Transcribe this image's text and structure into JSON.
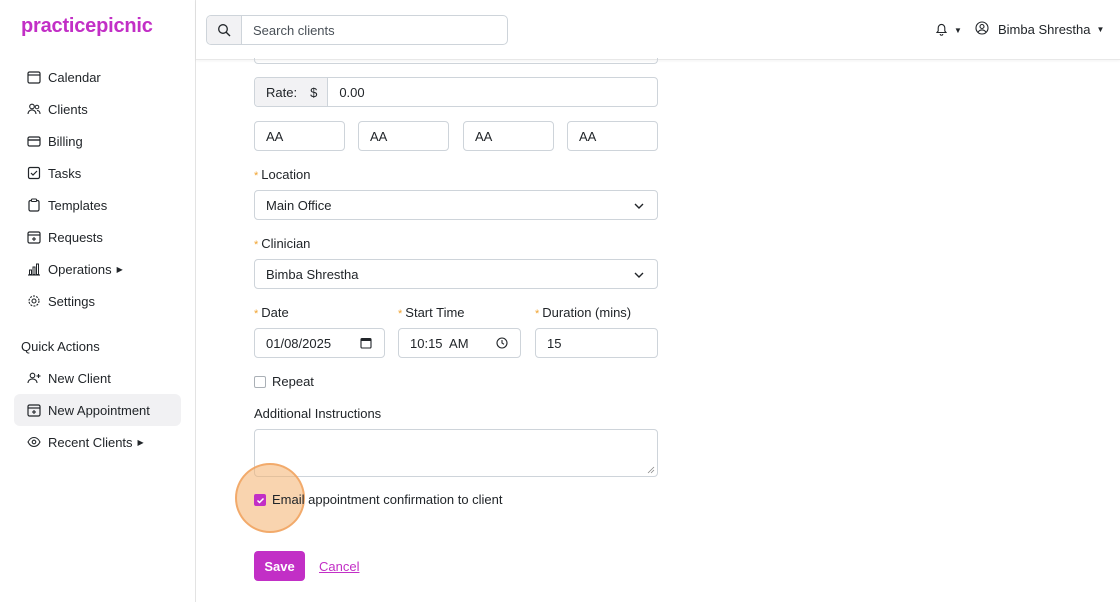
{
  "brand": {
    "name": "practicepicnic",
    "color": "#c22fc6"
  },
  "sidebar": {
    "items": [
      {
        "label": "Calendar",
        "icon": "calendar-icon"
      },
      {
        "label": "Clients",
        "icon": "users-icon"
      },
      {
        "label": "Billing",
        "icon": "credit-card-icon"
      },
      {
        "label": "Tasks",
        "icon": "checkbox-icon"
      },
      {
        "label": "Templates",
        "icon": "clipboard-icon"
      },
      {
        "label": "Requests",
        "icon": "calendar-plus-icon"
      },
      {
        "label": "Operations",
        "icon": "bar-chart-icon"
      },
      {
        "label": "Settings",
        "icon": "gear-icon"
      }
    ],
    "quick_actions_title": "Quick Actions",
    "quick_actions": [
      {
        "label": "New Client",
        "icon": "person-plus-icon"
      },
      {
        "label": "New Appointment",
        "icon": "calendar-plus-icon",
        "active": true
      },
      {
        "label": "Recent Clients",
        "icon": "eye-icon"
      }
    ]
  },
  "topbar": {
    "search_placeholder": "Search clients",
    "user_name": "Bimba Shrestha"
  },
  "form": {
    "rate_label": "Rate:",
    "currency": "$",
    "rate_value": "0.00",
    "codes": [
      "AA",
      "AA",
      "AA",
      "AA"
    ],
    "location_label": "Location",
    "location_value": "Main Office",
    "clinician_label": "Clinician",
    "clinician_value": "Bimba Shrestha",
    "date_label": "Date",
    "date_value": "01/08/2025",
    "start_time_label": "Start Time",
    "start_time_value": "10:15  AM",
    "duration_label": "Duration (mins)",
    "duration_value": "15",
    "repeat_label": "Repeat",
    "repeat_checked": false,
    "instructions_label": "Additional Instructions",
    "instructions_value": "",
    "email_label": "Email appointment confirmation to client",
    "email_checked": true,
    "save_label": "Save",
    "cancel_label": "Cancel"
  }
}
